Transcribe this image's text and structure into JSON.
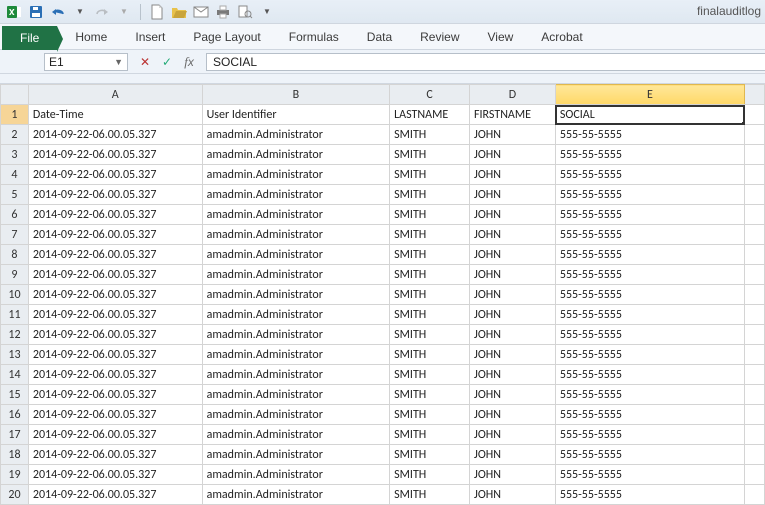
{
  "window": {
    "title_partial": "finalauditlog"
  },
  "ribbon": {
    "file": "File",
    "tabs": [
      "Home",
      "Insert",
      "Page Layout",
      "Formulas",
      "Data",
      "Review",
      "View",
      "Acrobat"
    ]
  },
  "namebox": {
    "value": "E1"
  },
  "formula_bar": {
    "value": "SOCIAL"
  },
  "grid": {
    "columns": [
      "A",
      "B",
      "C",
      "D",
      "E"
    ],
    "selected_cell": "E1",
    "headers": {
      "A": "Date-Time",
      "B": "User Identifier",
      "C": "LASTNAME",
      "D": "FIRSTNAME",
      "E": "SOCIAL"
    },
    "row_template": {
      "A": "2014-09-22-06.00.05.327",
      "B": "amadmin.Administrator",
      "C": "SMITH",
      "D": "JOHN",
      "E": "555-55-5555"
    },
    "first_data_row": 2,
    "last_data_row": 20
  }
}
